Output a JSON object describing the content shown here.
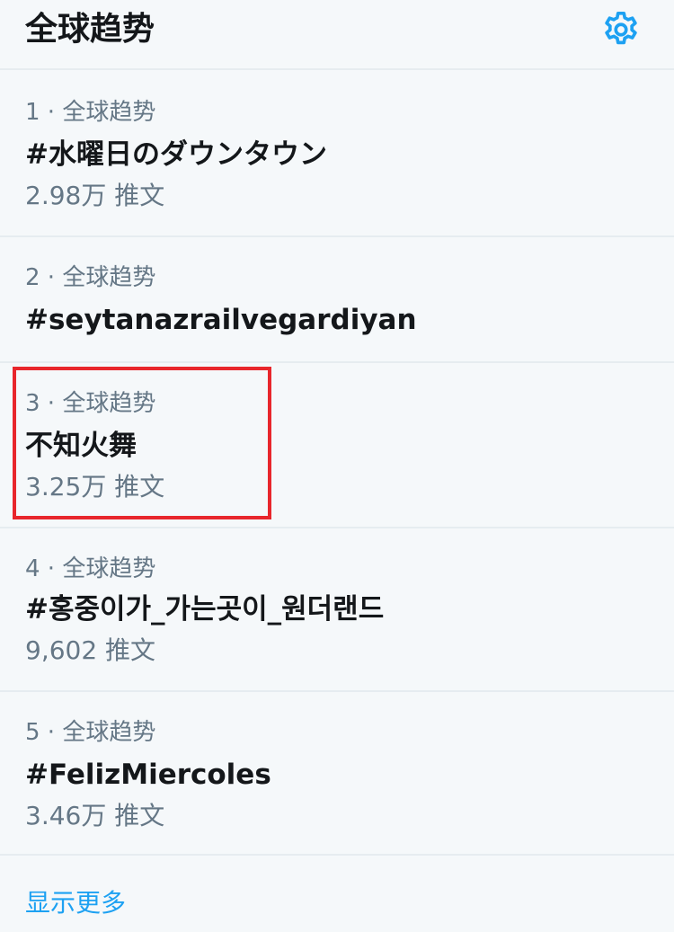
{
  "header": {
    "title": "全球趋势",
    "settings_icon": "gear-icon",
    "accent_color": "#1da1f2"
  },
  "trends": [
    {
      "meta": "1 · 全球趋势",
      "name": "#水曜日のダウンタウン",
      "count": "2.98万 推文"
    },
    {
      "meta": "2 · 全球趋势",
      "name": "#seytanazrailvegardiyan",
      "count": ""
    },
    {
      "meta": "3 · 全球趋势",
      "name": "不知火舞",
      "count": "3.25万 推文"
    },
    {
      "meta": "4 · 全球趋势",
      "name": "#홍중이가_가는곳이_원더랜드",
      "count": "9,602 推文"
    },
    {
      "meta": "5 · 全球趋势",
      "name": "#FelizMiercoles",
      "count": "3.46万 推文"
    }
  ],
  "footer": {
    "show_more": "显示更多"
  },
  "highlight_color": "#e8262c"
}
